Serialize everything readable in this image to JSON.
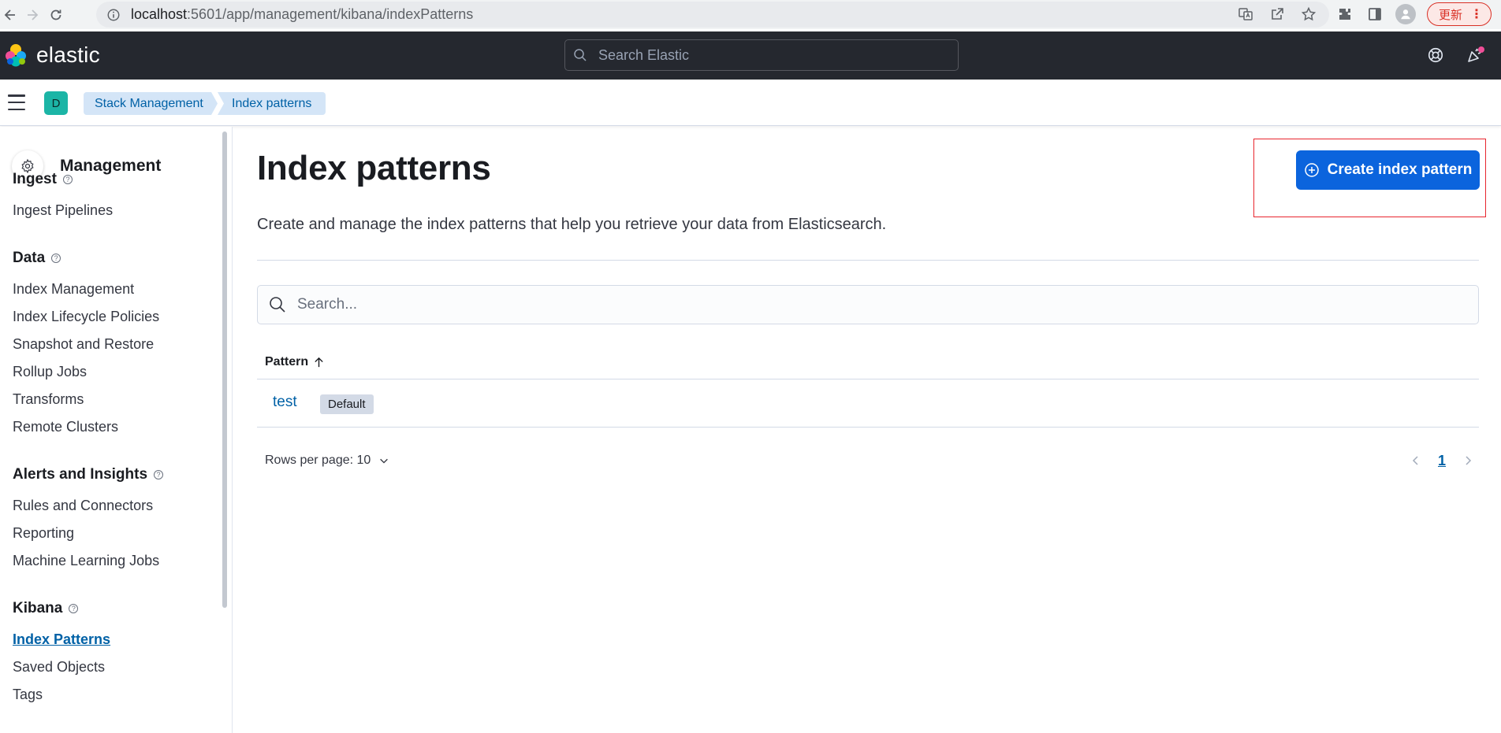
{
  "browser": {
    "url_host": "localhost",
    "url_path": ":5601/app/management/kibana/indexPatterns",
    "update_label": "更新"
  },
  "header": {
    "logo_text": "elastic",
    "search_placeholder": "Search Elastic"
  },
  "breadcrumbs": {
    "space_initial": "D",
    "items": [
      "Stack Management",
      "Index patterns"
    ]
  },
  "sidebar": {
    "title": "Management",
    "groups": [
      {
        "title": "Ingest",
        "items": [
          "Ingest Pipelines"
        ]
      },
      {
        "title": "Data",
        "items": [
          "Index Management",
          "Index Lifecycle Policies",
          "Snapshot and Restore",
          "Rollup Jobs",
          "Transforms",
          "Remote Clusters"
        ]
      },
      {
        "title": "Alerts and Insights",
        "items": [
          "Rules and Connectors",
          "Reporting",
          "Machine Learning Jobs"
        ]
      },
      {
        "title": "Kibana",
        "items": [
          "Index Patterns",
          "Saved Objects",
          "Tags"
        ]
      }
    ],
    "active_item": "Index Patterns"
  },
  "main": {
    "title": "Index patterns",
    "description": "Create and manage the index patterns that help you retrieve your data from Elasticsearch.",
    "create_button": "Create index pattern",
    "search_placeholder": "Search...",
    "table": {
      "column": "Pattern",
      "rows": [
        {
          "pattern": "test",
          "badge": "Default"
        }
      ]
    },
    "rows_per_page": "Rows per page: 10",
    "current_page": "1"
  },
  "colors": {
    "header_bg": "#25282f",
    "primary": "#0b64dd",
    "link": "#0061a6",
    "breadcrumb_bg": "#d4e5f7",
    "highlight_box": "#e8262e"
  }
}
